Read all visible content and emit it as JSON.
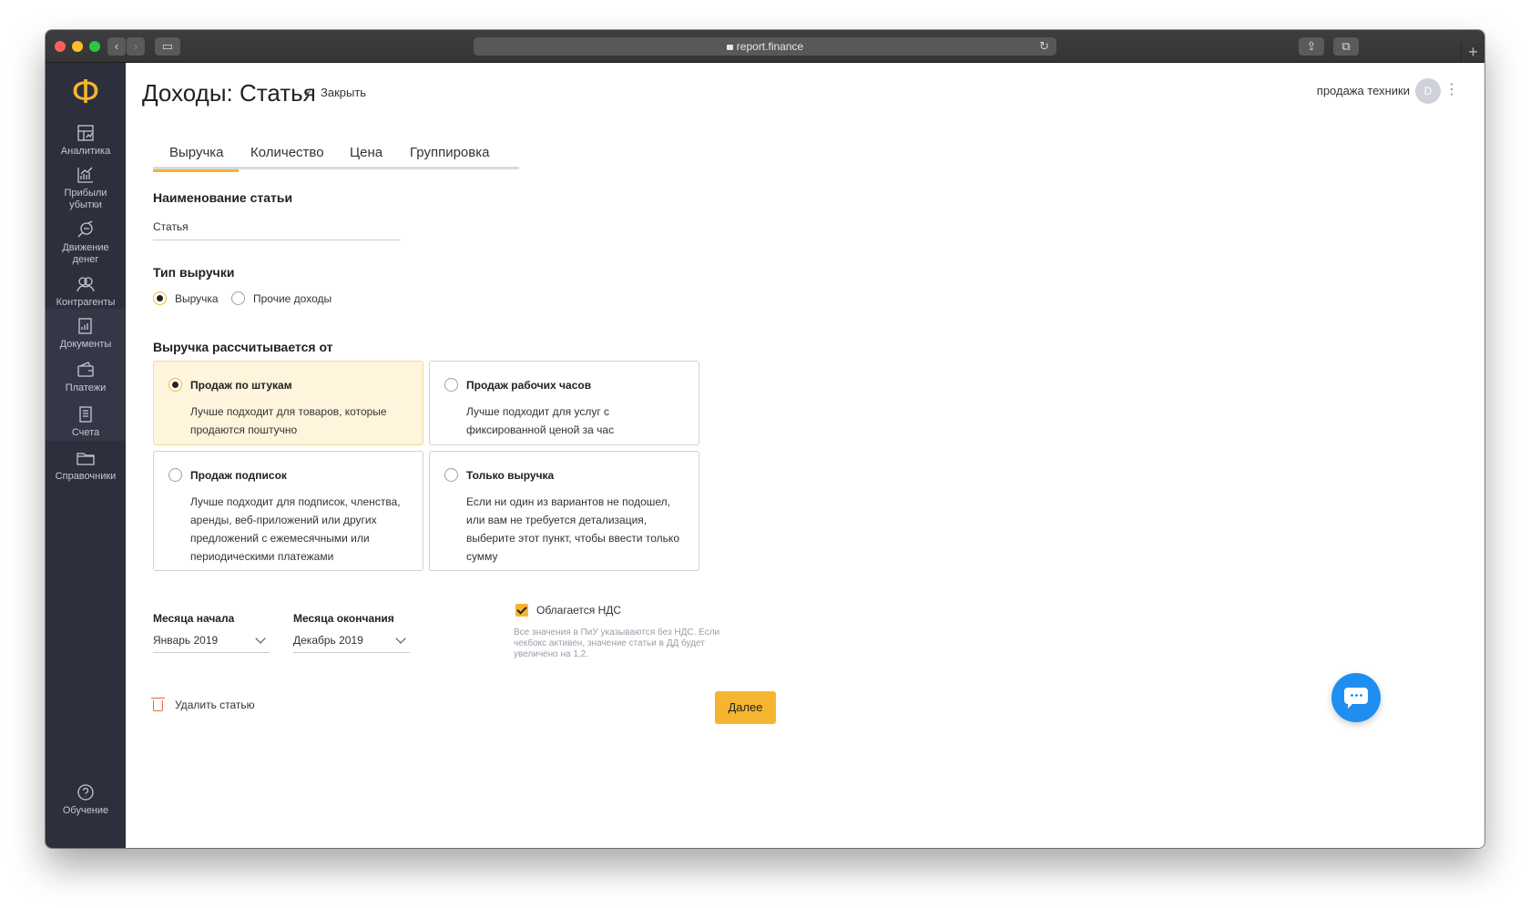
{
  "browser": {
    "url": "report.finance"
  },
  "sidebar": {
    "logo": "Ф",
    "items": [
      {
        "label": "Аналитика",
        "icon": "analytics-icon"
      },
      {
        "label": "Прибыли убытки",
        "icon": "profit-chart-icon"
      },
      {
        "label": "Движение денег",
        "icon": "money-flow-icon"
      },
      {
        "label": "Контрагенты",
        "icon": "contractors-icon"
      },
      {
        "label": "Документы",
        "icon": "documents-icon"
      },
      {
        "label": "Платежи",
        "icon": "wallet-icon"
      },
      {
        "label": "Счета",
        "icon": "invoice-icon"
      },
      {
        "label": "Справочники",
        "icon": "folder-icon"
      }
    ],
    "help": {
      "label": "Обучение",
      "icon": "help-icon"
    }
  },
  "header": {
    "title": "Доходы: Статья",
    "close_x": "×",
    "close_label": "Закрыть",
    "company": "продажа техники",
    "avatar": "D",
    "menu": "⋮"
  },
  "tabs": [
    {
      "label": "Выручка",
      "active": true
    },
    {
      "label": "Количество",
      "active": false
    },
    {
      "label": "Цена",
      "active": false
    },
    {
      "label": "Группировка",
      "active": false
    }
  ],
  "form": {
    "name_label": "Наименование статьи",
    "name_value": "Статья",
    "type_label": "Тип выручки",
    "type_options": [
      {
        "label": "Выручка",
        "selected": true
      },
      {
        "label": "Прочие доходы",
        "selected": false
      }
    ],
    "calc_label": "Выручка рассчитывается от",
    "calc_options": [
      {
        "title": "Продаж по штукам",
        "desc": "Лучше подходит для товаров, которые продаются поштучно",
        "selected": true
      },
      {
        "title": "Продаж рабочих часов",
        "desc": "Лучше подходит для услуг с фиксированной ценой за час",
        "selected": false
      },
      {
        "title": "Продаж подписок",
        "desc": "Лучше подходит для подписок, членства, аренды, веб-приложений или других предложений с ежемесячными или периодическими платежами",
        "selected": false
      },
      {
        "title": "Только выручка",
        "desc": "Если ни один из вариантов не подошел, или вам не требуется детализация, выберите этот пункт, чтобы ввести только сумму",
        "selected": false
      }
    ],
    "start_label": "Месяца начала",
    "start_value": "Январь 2019",
    "end_label": "Месяца окончания",
    "end_value": "Декабрь 2019",
    "vat_label": "Облагается НДС",
    "vat_checked": true,
    "vat_hint": "Все значения в ПиУ указываются без НДС. Если чекбокс активен, значение статьи в ДД будет увеличено на 1,2.",
    "delete_label": "Удалить статью",
    "next_label": "Далее"
  },
  "colors": {
    "accent": "#f6b531",
    "sidebar": "#2c303c",
    "chat": "#1e8ef0"
  }
}
